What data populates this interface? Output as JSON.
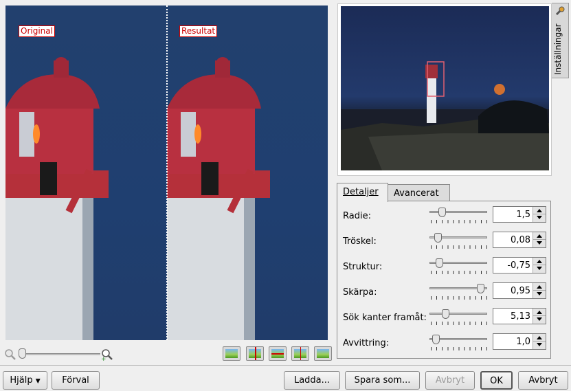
{
  "preview": {
    "original_label": "Original",
    "result_label": "Resultat"
  },
  "sidetab": {
    "label": "Inställningar",
    "icon": "wrench-icon"
  },
  "tabs": [
    {
      "label": "Detaljer",
      "active": true
    },
    {
      "label": "Avancerat",
      "active": false
    }
  ],
  "settings": [
    {
      "label": "Radie",
      "value": "1,5",
      "level": 0.18
    },
    {
      "label": "Tröskel",
      "value": "0,08",
      "level": 0.1
    },
    {
      "label": "Struktur",
      "value": "-0,75",
      "level": 0.12
    },
    {
      "label": "Skärpa",
      "value": "0,95",
      "level": 0.95
    },
    {
      "label": "Sök kanter framåt",
      "value": "5,13",
      "level": 0.25
    },
    {
      "label": "Avvittring",
      "value": "1,0",
      "level": 0.05
    }
  ],
  "buttons": {
    "help": "Hjälp",
    "defaults": "Förval",
    "load": "Ladda...",
    "save_as": "Spara som...",
    "abort": "Avbryt",
    "ok": "OK",
    "cancel": "Avbryt"
  },
  "colors": {
    "accent": "#cc0000",
    "sky": "#22406e"
  }
}
